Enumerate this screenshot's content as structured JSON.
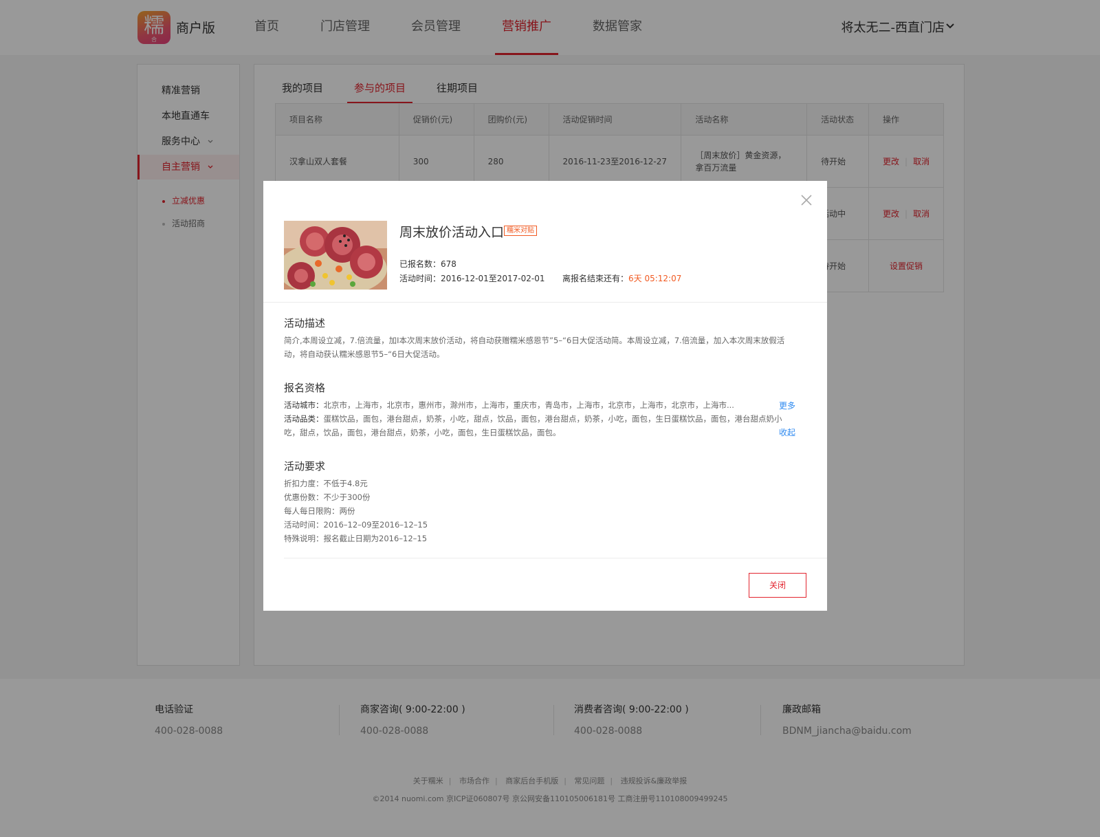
{
  "header": {
    "logo_char": "糯",
    "logo_sub": "合",
    "brand": "商户版",
    "nav": [
      "首页",
      "门店管理",
      "会员管理",
      "营销推广",
      "数据管家"
    ],
    "active_nav": "营销推广",
    "store_name": "将太无二-西直门店"
  },
  "sidebar": {
    "items": [
      "精准营销",
      "本地直通车",
      "服务中心",
      "自主营销"
    ],
    "active": "自主营销",
    "sub_items": [
      "立减优惠",
      "活动招商"
    ],
    "active_sub": "立减优惠"
  },
  "tabs": [
    "我的项目",
    "参与的项目",
    "往期项目"
  ],
  "active_tab": "参与的项目",
  "table": {
    "headers": [
      "项目名称",
      "促销价(元)",
      "团购价(元)",
      "活动促销时间",
      "活动名称",
      "活动状态",
      "操作"
    ],
    "rows": [
      {
        "name": "汉拿山双人套餐",
        "promo_price": "300",
        "group_price": "280",
        "time": "2016-11-23至2016-12-27",
        "activity_line1": "［周末放价］黄金资源，",
        "activity_line2": "拿百万流量",
        "status": "待开始",
        "op1": "更改",
        "op2": "取消"
      },
      {
        "status": "活动中",
        "op1": "更改",
        "op2": "取消"
      },
      {
        "status": "待开始",
        "op1": "设置促销"
      }
    ]
  },
  "footer": {
    "cols": [
      {
        "title": "电话验证",
        "value": "400-028-0088"
      },
      {
        "title": "商家咨询( 9:00-22:00 )",
        "value": "400-028-0088"
      },
      {
        "title": "消费者咨询( 9:00-22:00 )",
        "value": "400-028-0088"
      },
      {
        "title": "廉政邮箱",
        "value": "BDNM_jiancha@baidu.com"
      }
    ],
    "links": [
      "关于糯米",
      "市场合作",
      "商家后台手机版",
      "常见问题",
      "违规投诉&廉政举报"
    ],
    "copyright": "©2014 nuomi.com 京ICP证060807号 京公网安备110105006181号 工商注册号110108009499245"
  },
  "modal": {
    "title": "周末放价活动入口",
    "tag": "糯米对贴",
    "signup_label": "已报名数：",
    "signup_count": "678",
    "time_label": "活动时间：",
    "time_value": "2016-12-01至2017-02-01",
    "countdown_label": "离报名结束还有：",
    "countdown_value": "6天 05:12:07",
    "desc_title": "活动描述",
    "desc_text": "简介,本周设立减，7.倍流量，加I本次周末放价活动，将自动获赠糯米感恩节”5–“6日大促活动简。本周设立减，7.倍流量，加入本次周末放假活动，将自动获认糯米感恩节5–“6日大促活动。",
    "qual_title": "报名资格",
    "city_label": "活动城市：",
    "city_value": "北京市，上海市，北京市，惠州市，滁州市，上海市，重庆市，青岛市，上海市，北京市，上海市，北京市，上海市...",
    "more_link": "更多",
    "cat_label": "活动品类：",
    "cat_value": "蛋糕饮品，面包，港台甜点，奶茶，小吃，甜点，饮品，面包，港台甜点，奶茶，小吃，面包，生日蛋糕饮品，面包，港台甜点奶小吃，甜点，饮品，面包，港台甜点，奶茶，小吃，面包，生日蛋糕饮品，面包。",
    "collapse_link": "收起",
    "req_title": "活动要求",
    "requirements": [
      {
        "label": "折扣力度：",
        "value": "不低于4.8元"
      },
      {
        "label": "优惠份数：",
        "value": "不少于300份"
      },
      {
        "label": "每人每日限购：",
        "value": "两份"
      },
      {
        "label": "活动时间：",
        "value": "2016–12–09至2016–12–15"
      },
      {
        "label": "特殊说明：",
        "value": "报名截止日期为2016–12–15"
      }
    ],
    "close_button": "关闭"
  },
  "colors": {
    "accent": "#e2232d",
    "link": "#2f8af0",
    "countdown": "#f15a22"
  }
}
